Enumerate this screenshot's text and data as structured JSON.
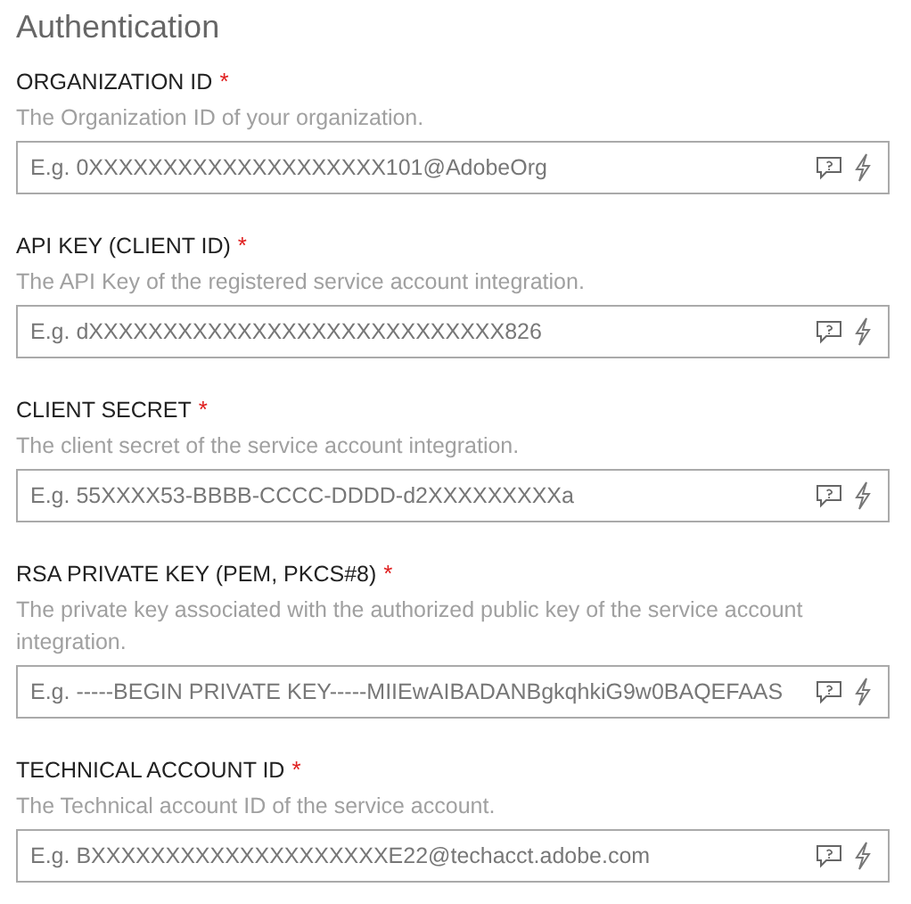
{
  "section_title": "Authentication",
  "fields": [
    {
      "label": "ORGANIZATION ID",
      "required_mark": "*",
      "description": "The Organization ID of your organization.",
      "placeholder": "E.g. 0XXXXXXXXXXXXXXXXXXXX101@AdobeOrg"
    },
    {
      "label": "API KEY (CLIENT ID)",
      "required_mark": "*",
      "description": "The API Key of the registered service account integration.",
      "placeholder": "E.g. dXXXXXXXXXXXXXXXXXXXXXXXXXXXX826"
    },
    {
      "label": "CLIENT SECRET",
      "required_mark": "*",
      "description": "The client secret of the service account integration.",
      "placeholder": "E.g. 55XXXX53-BBBB-CCCC-DDDD-d2XXXXXXXXXa"
    },
    {
      "label": "RSA PRIVATE KEY (PEM, PKCS#8)",
      "required_mark": "*",
      "description": "The private key associated with the authorized public key of the service account integration.",
      "placeholder": "E.g. -----BEGIN PRIVATE KEY-----MIIEwAIBADANBgkqhkiG9w0BAQEFAAS"
    },
    {
      "label": "TECHNICAL ACCOUNT ID",
      "required_mark": "*",
      "description": "The Technical account ID of the service account.",
      "placeholder": "E.g. BXXXXXXXXXXXXXXXXXXXXE22@techacct.adobe.com"
    }
  ]
}
